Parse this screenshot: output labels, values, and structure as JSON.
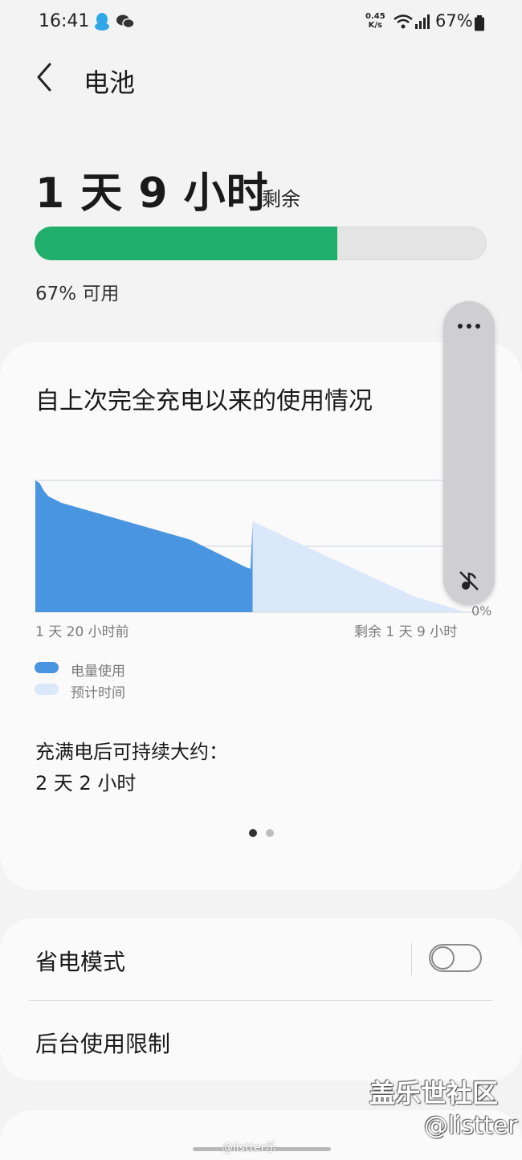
{
  "status_bar": {
    "time": "16:41",
    "net_speed_value": "0.45",
    "net_speed_unit": "K/s",
    "battery_percent": "67%",
    "icons": [
      "qq-icon",
      "wechat-icon",
      "wifi-icon",
      "signal-icon",
      "battery-icon"
    ]
  },
  "header": {
    "title": "电池",
    "back_icon": "back-chevron-icon"
  },
  "battery": {
    "remaining_time": "1 天 9 小时",
    "remaining_suffix": "剩余",
    "level": 0.67,
    "available_text": "67% 可用",
    "bar_color": "#1fae6b"
  },
  "usage_card": {
    "title": "自上次完全充电以来的使用情况",
    "x_start_label": "1 天 20 小时前",
    "x_end_label": "剩余 1 天 9 小时",
    "y_min_label": "0%",
    "legend": {
      "usage": "电量使用",
      "estimated": "预计时间"
    },
    "full_charge_label": "充满电后可持续大约：",
    "full_charge_value": "2 天 2 小时",
    "page_count": 2,
    "active_page": 1
  },
  "chart_data": {
    "type": "area",
    "xlabel": "",
    "ylabel": "",
    "ylim": [
      0,
      100
    ],
    "grid": true,
    "y_gridlines": [
      50,
      100
    ],
    "series": [
      {
        "name": "电量使用",
        "color": "#4a95e0",
        "points": [
          [
            0,
            100
          ],
          [
            1,
            98
          ],
          [
            2,
            92
          ],
          [
            3,
            88
          ],
          [
            6,
            83
          ],
          [
            20,
            70
          ],
          [
            36,
            55
          ],
          [
            49,
            34
          ],
          [
            50,
            33
          ],
          [
            50.5,
            69
          ]
        ]
      },
      {
        "name": "预计时间",
        "color": "#dbe8fa",
        "points": [
          [
            50.5,
            69
          ],
          [
            66,
            45
          ],
          [
            88,
            12
          ],
          [
            100,
            0
          ]
        ]
      }
    ]
  },
  "settings": {
    "power_saving_label": "省电模式",
    "power_saving_on": false,
    "background_limit_label": "后台使用限制"
  },
  "floating_panel": {
    "more_icon": "more-dots-icon",
    "mute_icon": "mute-icon"
  },
  "watermark": {
    "community": "盖乐世社区",
    "handle": "@listter",
    "weibo": "@listter乐"
  }
}
